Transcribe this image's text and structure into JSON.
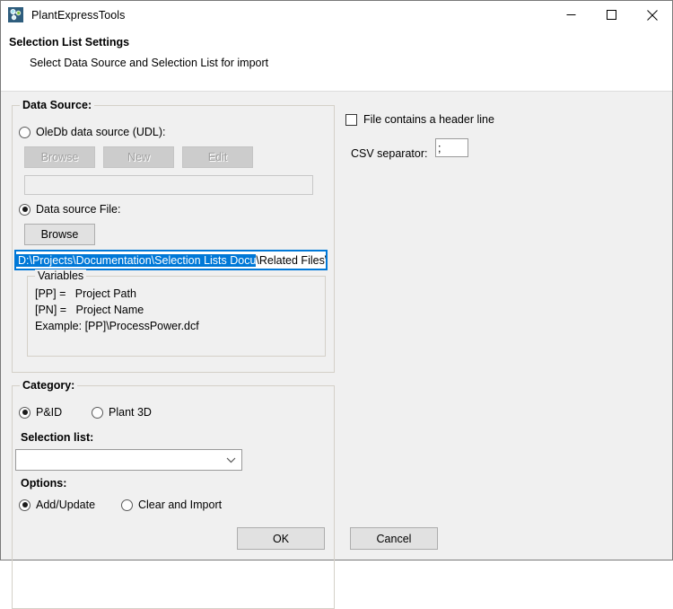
{
  "window": {
    "title": "PlantExpressTools",
    "icon": "plant-tools-icon",
    "controls": {
      "minimize": "minimize-icon",
      "maximize": "maximize-icon",
      "close": "close-icon"
    }
  },
  "header": {
    "title": "Selection List Settings",
    "subtitle": "Select Data Source and Selection List for import"
  },
  "data_source": {
    "legend": "Data Source:",
    "oledb_radio": {
      "label": "OleDb data source (UDL):",
      "checked": false
    },
    "buttons": {
      "browse": "Browse",
      "new": "New",
      "edit": "Edit"
    },
    "udl_path_value": "",
    "file_radio": {
      "label": "Data source File:",
      "checked": true
    },
    "file_browse_button": "Browse",
    "file_path": {
      "selected_text": "D:\\Projects\\Documentation\\Selection Lists Docu",
      "remaining_text": "\\Related Files\\Servic"
    },
    "variables": {
      "legend": "Variables",
      "lines": [
        "[PP] =   Project Path",
        "[PN] =   Project Name",
        "Example: [PP]\\ProcessPower.dcf"
      ]
    }
  },
  "category": {
    "legend": "Category:",
    "pid_radio": {
      "label": "P&ID",
      "checked": true
    },
    "plant3d_radio": {
      "label": "Plant 3D",
      "checked": false
    },
    "selection_list_label": "Selection list:",
    "selection_list_value": "",
    "options_label": "Options:",
    "add_update_radio": {
      "label": "Add/Update",
      "checked": true
    },
    "clear_import_radio": {
      "label": "Clear and Import",
      "checked": false
    }
  },
  "right_panel": {
    "header_line_checkbox": {
      "label": "File contains a header line",
      "checked": false
    },
    "csv_separator_label": "CSV separator:",
    "csv_separator_value": ";"
  },
  "footer": {
    "ok_button": "OK",
    "cancel_button": "Cancel"
  },
  "colors": {
    "accent": "#0078d7",
    "window_bg": "#f0f0f0",
    "title_bg": "#ffffff",
    "icon_bg": "#2e5d7d"
  }
}
